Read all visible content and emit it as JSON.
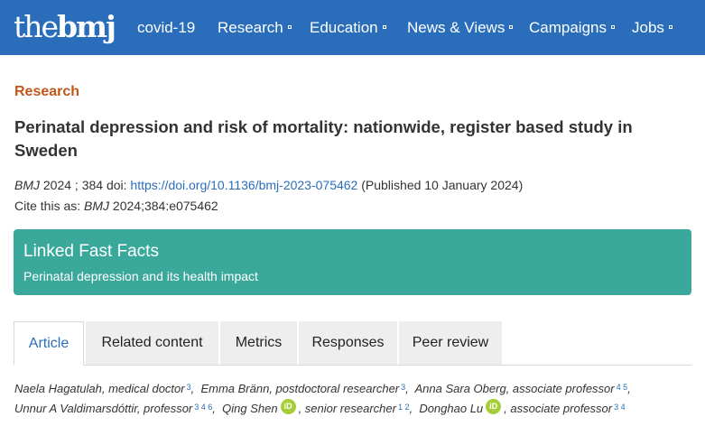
{
  "nav": {
    "logo_the": "the",
    "logo_bmj": "bmj",
    "items": [
      {
        "label": "covid-19",
        "dropdown": false
      },
      {
        "label": "Research",
        "dropdown": true
      },
      {
        "label": "Education",
        "dropdown": true
      },
      {
        "label": "News & Views",
        "dropdown": true
      },
      {
        "label": "Campaigns",
        "dropdown": true
      },
      {
        "label": "Jobs",
        "dropdown": true
      }
    ]
  },
  "article": {
    "section": "Research",
    "title": "Perinatal depression and risk of mortality: nationwide, register based study in Sweden",
    "journal": "BMJ",
    "year_volume": " 2024 ; 384  doi: ",
    "doi_url": "https://doi.org/10.1136/bmj-2023-075462",
    "published": " (Published 10 January 2024)",
    "cite_prefix": "Cite this as: ",
    "cite_journal": "BMJ",
    "cite_ref": " 2024;384:e075462"
  },
  "fast_facts": {
    "title": "Linked Fast Facts",
    "subtitle": "Perinatal depression and its health impact"
  },
  "tabs": [
    {
      "label": "Article",
      "active": true
    },
    {
      "label": "Related content",
      "active": false
    },
    {
      "label": "Metrics",
      "active": false
    },
    {
      "label": "Responses",
      "active": false
    },
    {
      "label": "Peer review",
      "active": false
    }
  ],
  "authors": {
    "a1_name": "Naela Hagatulah, medical doctor",
    "a1_sup": "3",
    "a2_name": "Emma Bränn, postdoctoral researcher",
    "a2_sup": "3",
    "a3_name": "Anna Sara Oberg, associate professor",
    "a3_sup": "4 5",
    "a4_name": "Unnur A Valdimarsdóttir, professor",
    "a4_sup": "3 4 6",
    "a5_name": "Qing Shen",
    "a5_role": ", senior researcher",
    "a5_sup": "1 2",
    "a6_name": "Donghao Lu",
    "a6_role": ", associate professor",
    "a6_sup": "3 4",
    "orcid_label": "iD"
  },
  "colors": {
    "brand_blue": "#2a6ebb",
    "section_orange": "#c0561b",
    "fast_facts_teal": "#3aa99b",
    "orcid_green": "#a6ce39"
  }
}
